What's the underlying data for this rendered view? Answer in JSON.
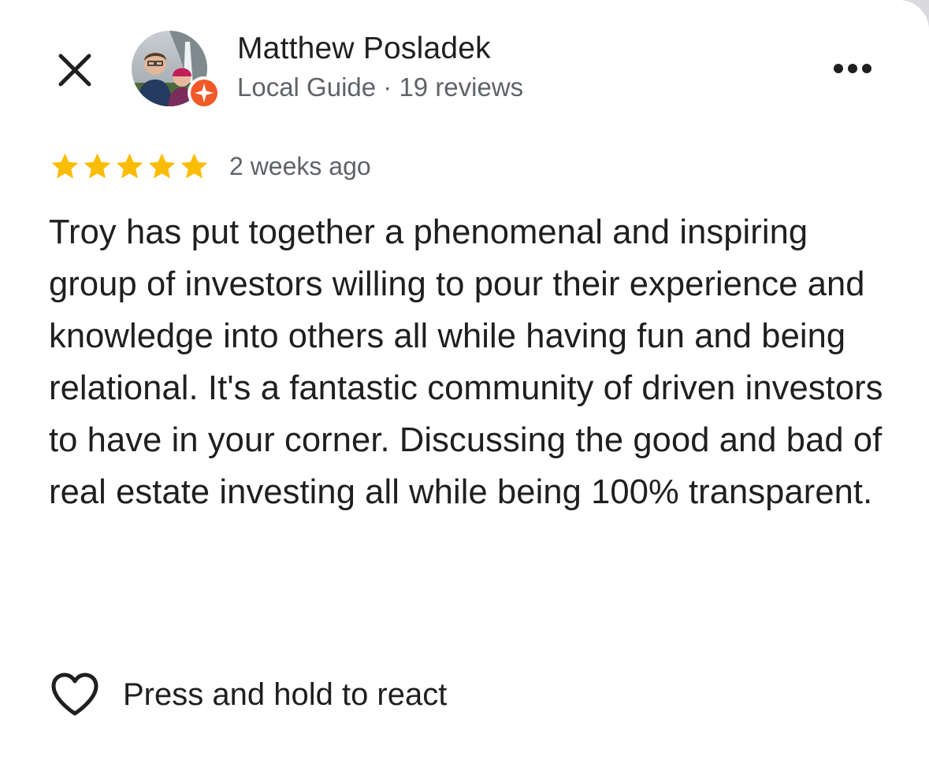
{
  "header": {
    "close_icon": "close-icon",
    "more_icon": "more-horizontal-icon"
  },
  "author": {
    "name": "Matthew Posladek",
    "meta": "Local Guide · 19 reviews",
    "badge_icon": "local-guide-badge-icon",
    "badge_color": "#f05a28"
  },
  "review": {
    "rating": 5,
    "max_rating": 5,
    "star_color": "#fbbc04",
    "date": "2 weeks ago",
    "text": "Troy has put together a phenomenal and inspiring group of investors willing to pour their experience and knowledge into others all while having fun and being relational. It's a fantastic community of driven investors to have in your corner. Discussing the good and bad of real estate investing all while being 100% transparent."
  },
  "reaction": {
    "icon": "heart-outline-icon",
    "label": "Press and hold to react"
  }
}
